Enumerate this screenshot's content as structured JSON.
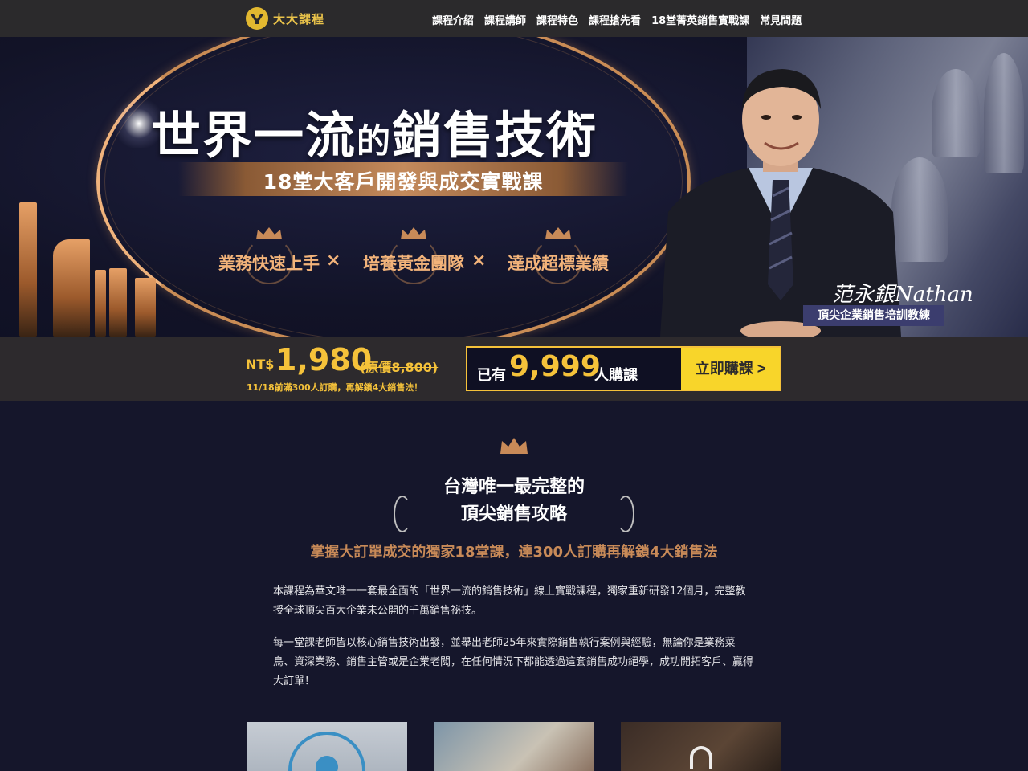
{
  "nav": {
    "logo_text": "大大課程",
    "items": [
      "課程介紹",
      "課程講師",
      "課程特色",
      "課程搶先看",
      "18堂菁英銷售實戰課",
      "常見問題"
    ]
  },
  "hero": {
    "title_a": "世界一流",
    "title_b": "的",
    "title_c": "銷售技術",
    "subtitle": "18堂大客戶開發與成交實戰課",
    "badges": [
      "業務快速上手",
      "培養黃金團隊",
      "達成超標業績"
    ],
    "separator": "×",
    "instructor_signature": "范永銀Nathan",
    "instructor_role": "頂尖企業銷售培訓教練"
  },
  "pricing": {
    "currency": "NT$",
    "price": "1,980",
    "original": "(原價8,800)",
    "note": "11/18前滿300人訂購，再解鎖4大銷售法！",
    "buyers_prefix": "已有",
    "buyers_count": "9,999",
    "buyers_suffix": "人購課",
    "cta": "立即購課 >"
  },
  "intro": {
    "title_line1": "台灣唯一最完整的",
    "title_line2": "頂尖銷售攻略",
    "subtitle": "掌握大訂單成交的獨家18堂課，達300人訂購再解鎖4大銷售法",
    "para1": "本課程為華文唯一一套最全面的「世界一流的銷售技術」線上實戰課程，獨家重新研發12個月，完整教授全球頂尖百大企業未公開的千萬銷售祕技。",
    "para2": "每一堂課老師皆以核心銷售技術出發，並舉出老師25年來實際銷售執行案例與經驗，無論你是業務菜鳥、資深業務、銷售主管或是企業老闆，在任何情況下都能透過這套銷售成功絕學，成功開拓客戶、贏得大訂單！"
  },
  "colors": {
    "accent_gold": "#f5c23a",
    "copper": "#c88a58",
    "cta_yellow": "#f8d52a",
    "navy": "#15162b"
  }
}
